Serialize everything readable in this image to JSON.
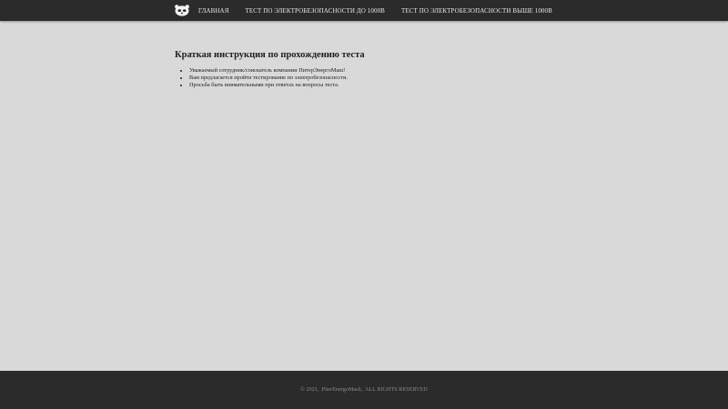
{
  "nav": {
    "logo_icon": "panda-logo-icon",
    "items": [
      {
        "label": "ГЛАВНАЯ"
      },
      {
        "label": "ТЕСТ ПО ЭЛЕКТРОБЕЗОПАСНОСТИ ДО 1000В"
      },
      {
        "label": "ТЕСТ ПО ЭЛЕКТРОБЕЗОПАСНОСТИ ВЫШЕ 1000В"
      }
    ]
  },
  "main": {
    "title": "Краткая инструкция по прохождению теста",
    "instructions": [
      "Уважаемый сотрудник/соискатель компании ПитерЭнергоМаш!",
      "Вам предлагается пройти тестирование по электробезопасности.",
      "Просьба быть внимательными при ответах на вопросы теста."
    ]
  },
  "footer": {
    "copyright": "© 2021,  PiterEnergoMash,  ALL RIGHTS RESERVED"
  },
  "colors": {
    "navbar_bg": "#2b2b2b",
    "page_bg": "#d9d9d9",
    "footer_bg": "#2b2b2b",
    "nav_text": "#e6e6e6",
    "footer_text": "#8a8a8a"
  }
}
